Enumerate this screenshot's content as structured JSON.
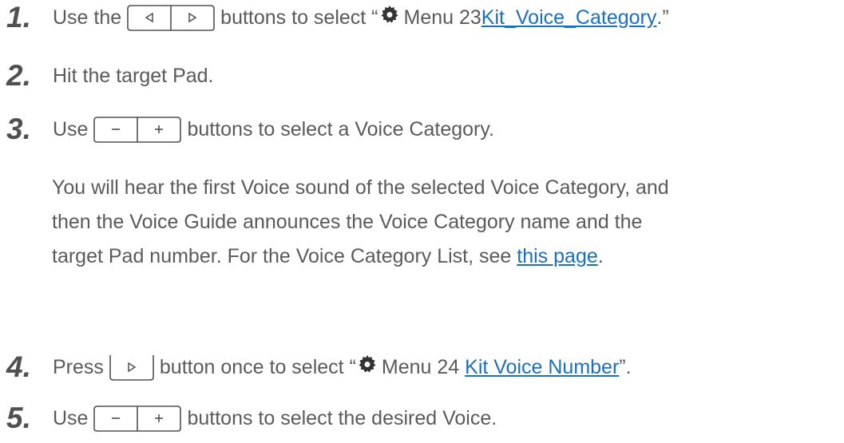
{
  "steps": [
    {
      "number": "1.",
      "pre": "Use the",
      "post": "buttons to select “",
      "gear": "gear-icon",
      "menu": "Menu 23",
      "link": " Kit_Voice_Category",
      "end": ".”"
    },
    {
      "number": "2.",
      "text": "Hit the target Pad."
    },
    {
      "number": "3.",
      "pre": "Use",
      "post": "buttons to select a Voice Category."
    },
    {
      "number": "4.",
      "pre": "Press",
      "post": "button once to select “",
      "menu": "Menu 24",
      "link": "Kit Voice Number",
      "end": "”."
    },
    {
      "number": "5.",
      "pre": "Use",
      "post": "buttons to select the desired Voice."
    }
  ],
  "note": {
    "line1": "You will hear the first Voice sound of the selected Voice Category, and",
    "line2": "then the Voice Guide announces the Voice Category name and the",
    "line3_pre": "target Pad number. For the Voice Category List, see",
    "line3_link": "this page",
    "line3_end": "."
  },
  "colors": {
    "text": "#5a5a5a",
    "link": "#1a6fc2"
  }
}
